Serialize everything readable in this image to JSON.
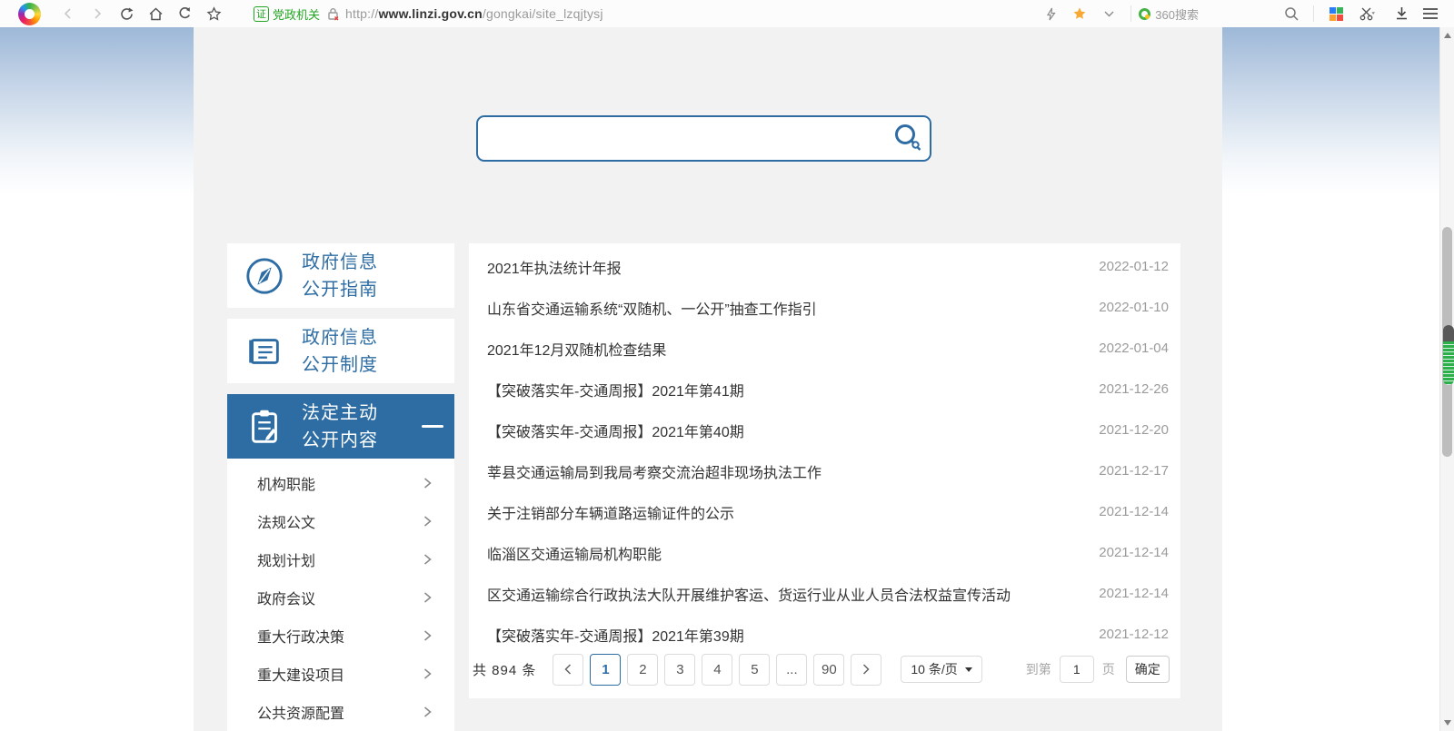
{
  "colors": {
    "accent_blue": "#2e6da4",
    "badge_green": "#23a523",
    "content_bg": "#f2f2f2",
    "date_gray": "#9b9b9b",
    "star_orange": "#f7a934",
    "grip_green": "#2db04c"
  },
  "browser": {
    "site_badge": "证",
    "site_badge_label": "党政机关",
    "url_prefix": "http://",
    "url_host": "www.linzi.gov.cn",
    "url_path": "/gongkai/site_lzqjtysj",
    "search_engine_label": "360搜索"
  },
  "search": {
    "value": "",
    "placeholder": ""
  },
  "sidebar": {
    "cards": [
      {
        "line1": "政府信息",
        "line2": "公开指南",
        "icon": "compass-icon",
        "active": false
      },
      {
        "line1": "政府信息",
        "line2": "公开制度",
        "icon": "document-icon",
        "active": false
      },
      {
        "line1": "法定主动",
        "line2": "公开内容",
        "icon": "clipboard-icon",
        "active": true
      }
    ],
    "items": [
      {
        "label": "机构职能"
      },
      {
        "label": "法规公文"
      },
      {
        "label": "规划计划"
      },
      {
        "label": "政府会议"
      },
      {
        "label": "重大行政决策"
      },
      {
        "label": "重大建设项目"
      },
      {
        "label": "公共资源配置"
      }
    ]
  },
  "list": {
    "rows": [
      {
        "title": "2021年执法统计年报",
        "date": "2022-01-12"
      },
      {
        "title": "山东省交通运输系统“双随机、一公开”抽查工作指引",
        "date": "2022-01-10"
      },
      {
        "title": "2021年12月双随机检查结果",
        "date": "2022-01-04"
      },
      {
        "title": "【突破落实年-交通周报】2021年第41期",
        "date": "2021-12-26"
      },
      {
        "title": "【突破落实年-交通周报】2021年第40期",
        "date": "2021-12-20"
      },
      {
        "title": "莘县交通运输局到我局考察交流治超非现场执法工作",
        "date": "2021-12-17"
      },
      {
        "title": "关于注销部分车辆道路运输证件的公示",
        "date": "2021-12-14"
      },
      {
        "title": "临淄区交通运输局机构职能",
        "date": "2021-12-14"
      },
      {
        "title": "区交通运输综合行政执法大队开展维护客运、货运行业从业人员合法权益宣传活动",
        "date": "2021-12-14"
      },
      {
        "title": "【突破落实年-交通周报】2021年第39期",
        "date": "2021-12-12"
      }
    ]
  },
  "pagination": {
    "total_label": "共 894 条",
    "pages": [
      {
        "label": "1",
        "active": true
      },
      {
        "label": "2",
        "active": false
      },
      {
        "label": "3",
        "active": false
      },
      {
        "label": "4",
        "active": false
      },
      {
        "label": "5",
        "active": false
      },
      {
        "label": "...",
        "active": false
      },
      {
        "label": "90",
        "active": false
      }
    ],
    "page_size_label": "10 条/页",
    "goto_prefix": "到第",
    "goto_value": "1",
    "goto_suffix": "页",
    "confirm_label": "确定"
  }
}
